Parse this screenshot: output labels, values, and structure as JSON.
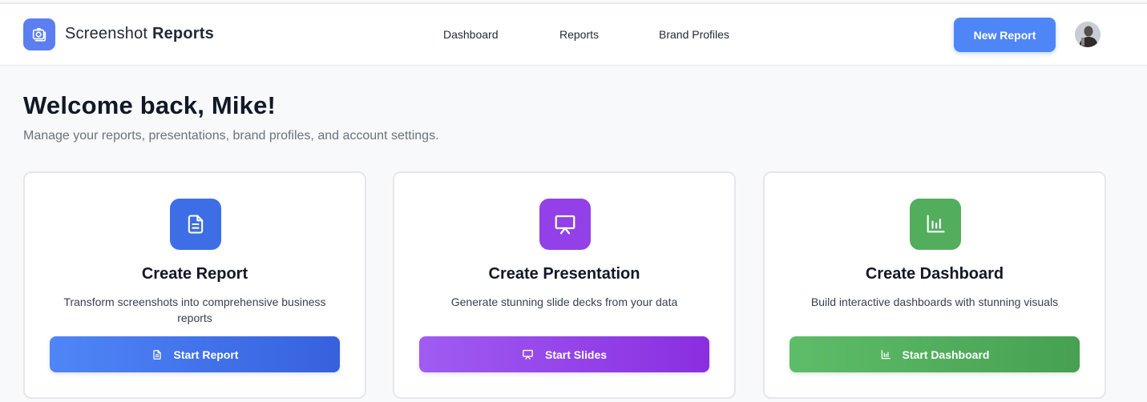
{
  "header": {
    "brand_regular": "Screenshot ",
    "brand_bold": "Reports",
    "nav": [
      {
        "label": "Dashboard"
      },
      {
        "label": "Reports"
      },
      {
        "label": "Brand Profiles"
      }
    ],
    "new_report_label": "New Report",
    "logo_icon": "camera-icon",
    "accent": "#4f86f7"
  },
  "main": {
    "welcome": "Welcome back, Mike!",
    "subtitle": "Manage your reports, presentations, brand profiles, and account settings."
  },
  "cards": [
    {
      "icon": "document-icon",
      "title": "Create Report",
      "description": "Transform screenshots into comprehensive business reports",
      "button": "Start Report",
      "color": "#3d6ee6"
    },
    {
      "icon": "presentation-icon",
      "title": "Create Presentation",
      "description": "Generate stunning slide decks from your data",
      "button": "Start Slides",
      "color": "#9340e8"
    },
    {
      "icon": "bar-chart-icon",
      "title": "Create Dashboard",
      "description": "Build interactive dashboards with stunning visuals",
      "button": "Start Dashboard",
      "color": "#52ae5d"
    }
  ]
}
